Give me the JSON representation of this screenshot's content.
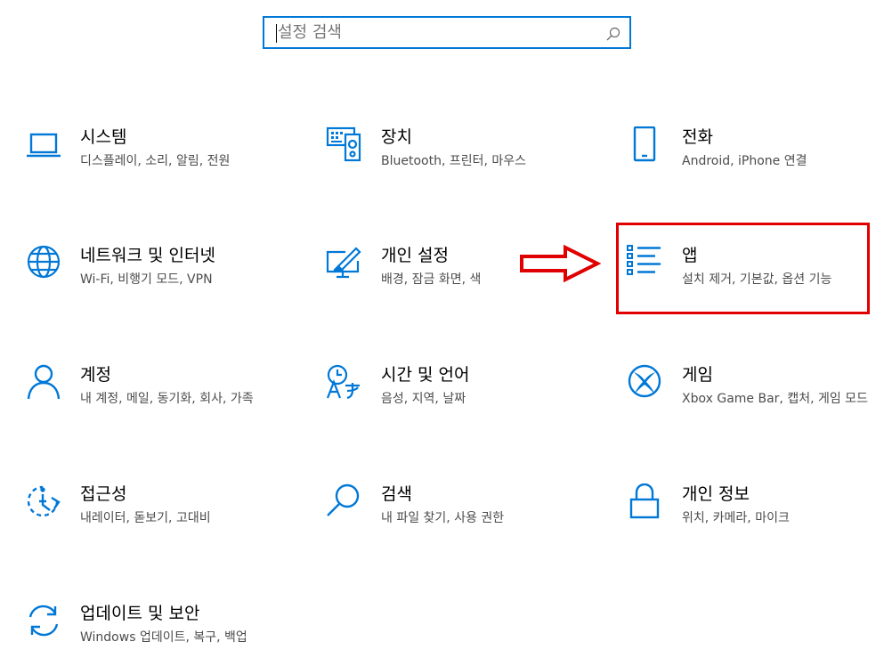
{
  "search": {
    "placeholder": "설정 검색",
    "icon": "search-icon"
  },
  "colors": {
    "accent": "#0078d7",
    "annotation": "#e00000"
  },
  "tiles": [
    {
      "title": "시스템",
      "desc": "디스플레이, 소리, 알림, 전원",
      "icon": "laptop-icon"
    },
    {
      "title": "장치",
      "desc": "Bluetooth, 프린터, 마우스",
      "icon": "devices-icon"
    },
    {
      "title": "전화",
      "desc": "Android, iPhone 연결",
      "icon": "phone-icon"
    },
    {
      "title": "네트워크 및 인터넷",
      "desc": "Wi-Fi, 비행기 모드, VPN",
      "icon": "globe-icon"
    },
    {
      "title": "개인 설정",
      "desc": "배경, 잠금 화면, 색",
      "icon": "personalization-icon"
    },
    {
      "title": "앱",
      "desc": "설치 제거, 기본값, 옵션 기능",
      "icon": "apps-list-icon"
    },
    {
      "title": "계정",
      "desc": "내 계정, 메일, 동기화, 회사, 가족",
      "icon": "person-icon"
    },
    {
      "title": "시간 및 언어",
      "desc": "음성, 지역, 날짜",
      "icon": "time-language-icon"
    },
    {
      "title": "게임",
      "desc": "Xbox Game Bar, 캡처, 게임 모드",
      "icon": "xbox-icon"
    },
    {
      "title": "접근성",
      "desc": "내레이터, 돋보기, 고대비",
      "icon": "ease-of-access-icon"
    },
    {
      "title": "검색",
      "desc": "내 파일 찾기, 사용 권한",
      "icon": "search-icon"
    },
    {
      "title": "개인 정보",
      "desc": "위치, 카메라, 마이크",
      "icon": "lock-icon"
    },
    {
      "title": "업데이트 및 보안",
      "desc": "Windows 업데이트, 복구, 백업",
      "icon": "sync-icon"
    }
  ]
}
